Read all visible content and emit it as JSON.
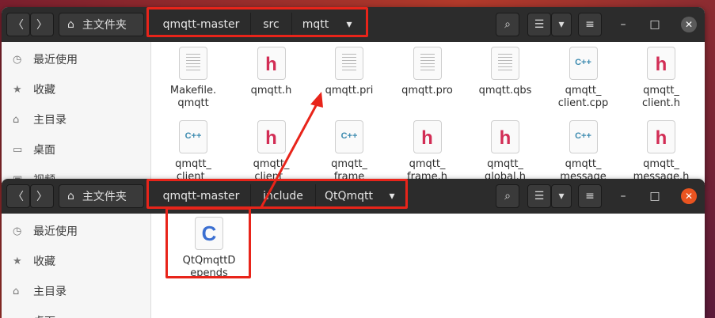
{
  "window1": {
    "path": [
      "qmqtt-master",
      "src",
      "mqtt"
    ],
    "home_label": "主文件夹",
    "sidebar": [
      {
        "icon": "clock-icon",
        "label": "最近使用"
      },
      {
        "icon": "star-icon",
        "label": "收藏"
      },
      {
        "icon": "home-icon",
        "label": "主目录"
      },
      {
        "icon": "desktop-icon",
        "label": "桌面"
      },
      {
        "icon": "video-icon",
        "label": "视频"
      }
    ],
    "files_row1": [
      {
        "name": "Makefile.\nqmqtt",
        "type": "text"
      },
      {
        "name": "qmqtt.h",
        "type": "h"
      },
      {
        "name": "qmqtt.pri",
        "type": "text"
      },
      {
        "name": "qmqtt.pro",
        "type": "text"
      },
      {
        "name": "qmqtt.qbs",
        "type": "text"
      },
      {
        "name": "qmqtt_\nclient.cpp",
        "type": "cpp"
      },
      {
        "name": "qmqtt_\nclient.h",
        "type": "h"
      }
    ],
    "files_row2": [
      {
        "name": "qmqtt_\nclient_",
        "type": "cpp"
      },
      {
        "name": "qmqtt_\nclient_",
        "type": "h"
      },
      {
        "name": "qmqtt_\nframe",
        "type": "cpp"
      },
      {
        "name": "qmqtt_\nframe.h",
        "type": "h"
      },
      {
        "name": "qmqtt_\nglobal.h",
        "type": "h"
      },
      {
        "name": "qmqtt_\nmessage",
        "type": "cpp"
      },
      {
        "name": "qmqtt_\nmessage.h",
        "type": "h"
      }
    ]
  },
  "window2": {
    "path": [
      "qmqtt-master",
      "include",
      "QtQmqtt"
    ],
    "home_label": "主文件夹",
    "sidebar": [
      {
        "icon": "clock-icon",
        "label": "最近使用"
      },
      {
        "icon": "star-icon",
        "label": "收藏"
      },
      {
        "icon": "home-icon",
        "label": "主目录"
      },
      {
        "icon": "desktop-icon",
        "label": "桌面"
      }
    ],
    "files": [
      {
        "name": "QtQmqttD\nepends",
        "type": "c"
      }
    ]
  },
  "controls": {
    "back": "〈",
    "forward": "〉",
    "search": "⌕",
    "list": "☰",
    "dropdown": "▾",
    "menu": "≡",
    "minimize": "–",
    "maximize": "□",
    "close": "✕"
  },
  "colors": {
    "highlight": "#e8241a",
    "header": "#2c2c2c",
    "close_active": "#e95420"
  }
}
